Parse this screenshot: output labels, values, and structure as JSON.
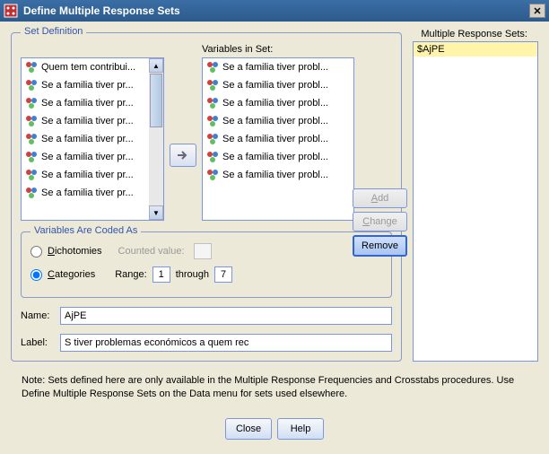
{
  "window": {
    "title": "Define Multiple Response Sets"
  },
  "set_definition": {
    "legend": "Set Definition",
    "variables_in_set_label": "Variables in Set:",
    "source_list": [
      "Quem tem contribui...",
      "Se a familia tiver pr...",
      "Se a familia tiver pr...",
      "Se a familia tiver pr...",
      "Se a familia tiver pr...",
      "Se a familia tiver pr...",
      "Se a familia tiver pr...",
      "Se a familia tiver pr..."
    ],
    "target_list": [
      "Se a familia tiver probl...",
      "Se a familia tiver probl...",
      "Se a familia tiver probl...",
      "Se a familia tiver probl...",
      "Se a familia tiver probl...",
      "Se a familia tiver probl...",
      "Se a familia tiver probl..."
    ]
  },
  "coded_as": {
    "legend": "Variables Are Coded As",
    "dichotomies_label": "Dichotomies",
    "counted_value_label": "Counted value:",
    "categories_label": "Categories",
    "range_label": "Range:",
    "range_from": "1",
    "through_label": "through",
    "range_to": "7",
    "selected": "categories"
  },
  "fields": {
    "name_label": "Name:",
    "name_value": "AjPE",
    "label_label": "Label:",
    "label_value": "S tiver problemas económicos a quem rec"
  },
  "mrs": {
    "header": "Multiple Response Sets:",
    "items": [
      "$AjPE"
    ]
  },
  "buttons": {
    "add": "Add",
    "change": "Change",
    "remove": "Remove",
    "close": "Close",
    "help": "Help"
  },
  "note": "Note: Sets defined here are only available in the Multiple Response Frequencies and Crosstabs procedures. Use Define Multiple Response Sets on the Data menu for sets used elsewhere."
}
